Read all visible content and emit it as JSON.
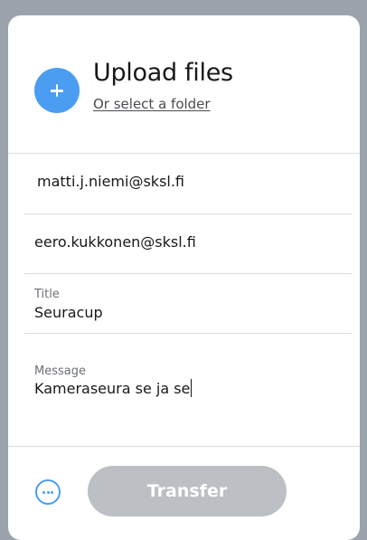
{
  "upload": {
    "title": "Upload files",
    "select_folder_label": "Or select a folder",
    "add_icon": "plus-icon"
  },
  "recipients": [
    "matti.j.niemi@sksl.fi",
    "eero.kukkonen@sksl.fi"
  ],
  "title_field": {
    "label": "Title",
    "value": "Seuracup"
  },
  "message_field": {
    "label": "Message",
    "value": "Kameraseura se ja se"
  },
  "footer": {
    "more_icon": "more-options-icon",
    "transfer_label": "Transfer",
    "transfer_enabled": false
  },
  "colors": {
    "accent": "#4b9df2",
    "disabled_button": "#bcbfc3",
    "backdrop": "#9aa3ab"
  }
}
